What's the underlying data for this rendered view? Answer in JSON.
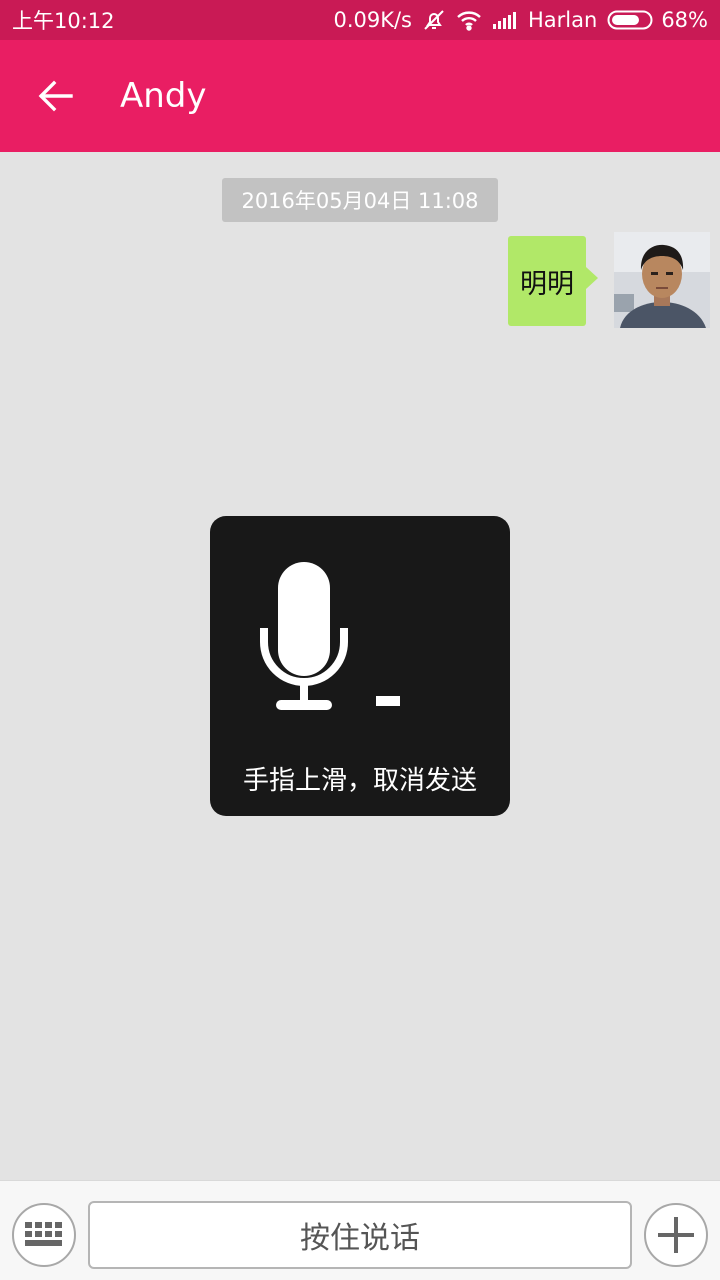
{
  "status_bar": {
    "time": "上午10:12",
    "network_speed": "0.09K/s",
    "carrier": "Harlan",
    "battery": "68%",
    "icons": [
      "alarm-off-icon",
      "wifi-icon",
      "signal-icon",
      "battery-icon"
    ]
  },
  "app_bar": {
    "title": "Andy",
    "back_icon": "arrow-left-icon"
  },
  "chat": {
    "timestamp": "2016年05月04日 11:08",
    "messages": [
      {
        "text": "明明",
        "sender": "self"
      }
    ]
  },
  "recording": {
    "hint": "手指上滑，取消发送",
    "icon": "microphone-icon"
  },
  "input_bar": {
    "hold_to_talk_label": "按住说话",
    "left_icon": "keyboard-icon",
    "right_icon": "plus-icon"
  },
  "colors": {
    "status_bar": "#c91a55",
    "app_bar": "#e91e63",
    "chat_background": "#e3e3e3",
    "bubble": "#b1e868",
    "overlay": "#181818"
  }
}
